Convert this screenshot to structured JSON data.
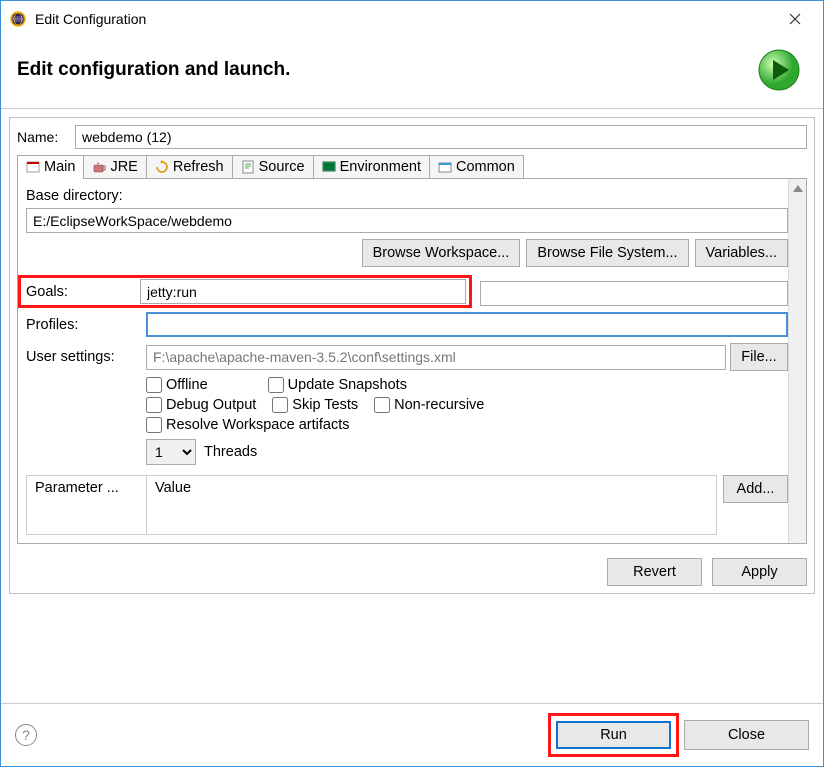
{
  "titlebar": {
    "title": "Edit Configuration"
  },
  "header": {
    "heading": "Edit configuration and launch."
  },
  "name": {
    "label": "Name:",
    "value": "webdemo (12)"
  },
  "tabs": {
    "main": "Main",
    "jre": "JRE",
    "refresh": "Refresh",
    "source": "Source",
    "environment": "Environment",
    "common": "Common"
  },
  "form": {
    "base_dir_label": "Base directory:",
    "base_dir_value": "E:/EclipseWorkSpace/webdemo",
    "browse_ws": "Browse Workspace...",
    "browse_fs": "Browse File System...",
    "variables": "Variables...",
    "goals_label": "Goals:",
    "goals_value": "jetty:run",
    "profiles_label": "Profiles:",
    "profiles_value": "",
    "user_settings_label": "User settings:",
    "user_settings_value": "F:\\apache\\apache-maven-3.5.2\\conf\\settings.xml",
    "file_btn": "File...",
    "offline": "Offline",
    "update_snapshots": "Update Snapshots",
    "debug_output": "Debug Output",
    "skip_tests": "Skip Tests",
    "non_recursive": "Non-recursive",
    "resolve_workspace": "Resolve Workspace artifacts",
    "threads_value": "1",
    "threads_label": "Threads",
    "param_header": "Parameter ...",
    "value_header": "Value",
    "add_btn": "Add..."
  },
  "buttons": {
    "revert": "Revert",
    "apply": "Apply",
    "run": "Run",
    "close": "Close"
  }
}
